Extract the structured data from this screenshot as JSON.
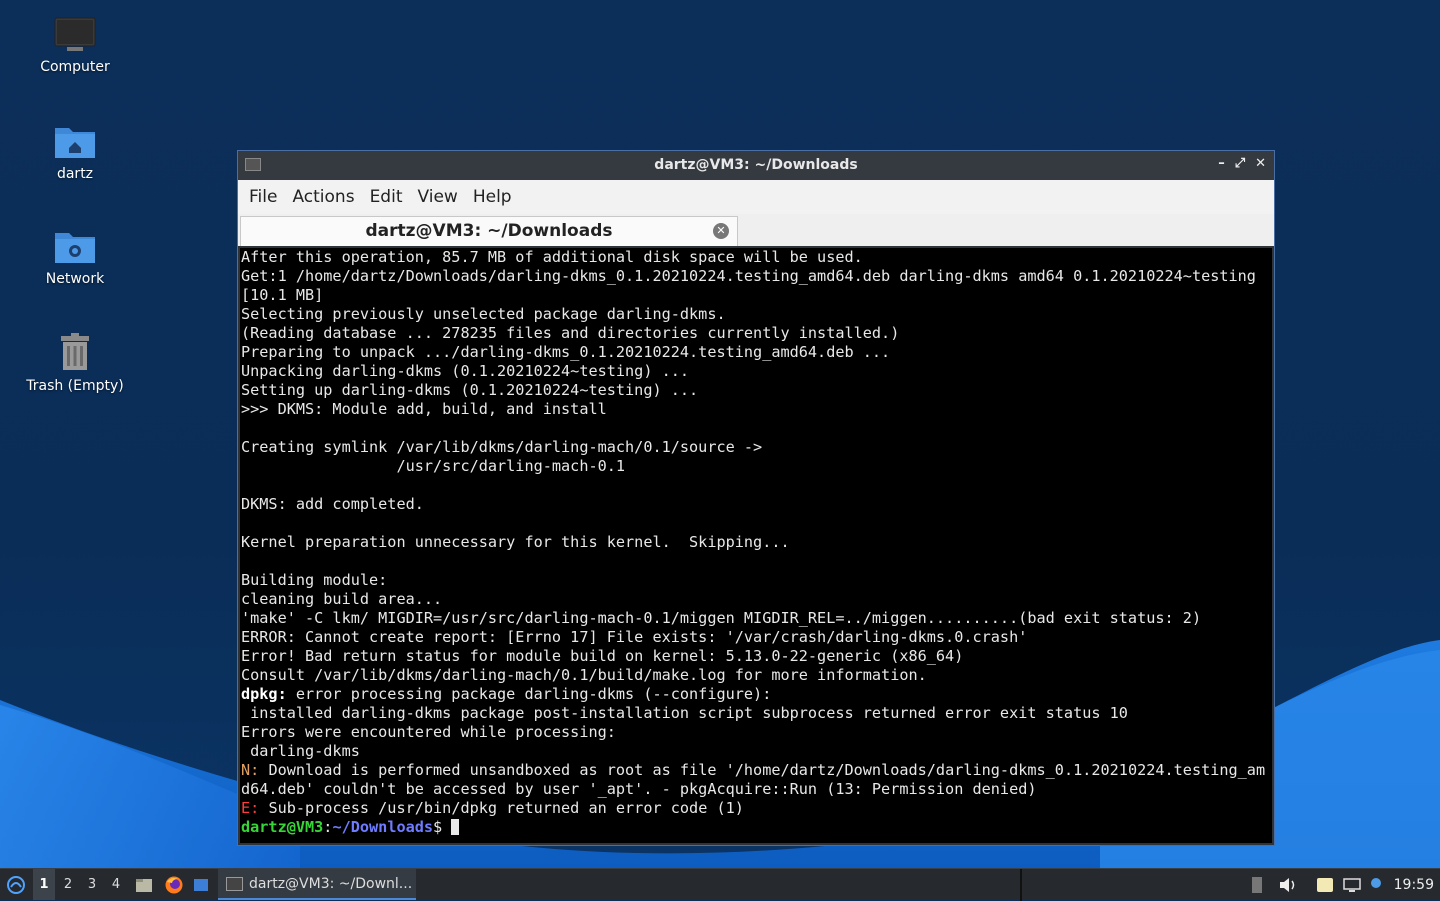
{
  "desktop": {
    "icons": [
      {
        "label": "Computer",
        "icon": "computer-icon"
      },
      {
        "label": "dartz",
        "icon": "home-folder-icon"
      },
      {
        "label": "Network",
        "icon": "network-folder-icon"
      },
      {
        "label": "Trash (Empty)",
        "icon": "trash-icon"
      }
    ]
  },
  "window": {
    "title": "dartz@VM3: ~/Downloads",
    "menu": [
      "File",
      "Actions",
      "Edit",
      "View",
      "Help"
    ],
    "tab_label": "dartz@VM3: ~/Downloads"
  },
  "terminal": {
    "lines": [
      "After this operation, 85.7 MB of additional disk space will be used.",
      "Get:1 /home/dartz/Downloads/darling-dkms_0.1.20210224.testing_amd64.deb darling-dkms amd64 0.1.20210224~testing",
      "[10.1 MB]",
      "Selecting previously unselected package darling-dkms.",
      "(Reading database ... 278235 files and directories currently installed.)",
      "Preparing to unpack .../darling-dkms_0.1.20210224.testing_amd64.deb ...",
      "Unpacking darling-dkms (0.1.20210224~testing) ...",
      "Setting up darling-dkms (0.1.20210224~testing) ...",
      ">>> DKMS: Module add, build, and install",
      "",
      "Creating symlink /var/lib/dkms/darling-mach/0.1/source ->",
      "                 /usr/src/darling-mach-0.1",
      "",
      "DKMS: add completed.",
      "",
      "Kernel preparation unnecessary for this kernel.  Skipping...",
      "",
      "Building module:",
      "cleaning build area...",
      "'make' -C lkm/ MIGDIR=/usr/src/darling-mach-0.1/miggen MIGDIR_REL=../miggen..........(bad exit status: 2)",
      "ERROR: Cannot create report: [Errno 17] File exists: '/var/crash/darling-dkms.0.crash'",
      "Error! Bad return status for module build on kernel: 5.13.0-22-generic (x86_64)",
      "Consult /var/lib/dkms/darling-mach/0.1/build/make.log for more information."
    ],
    "dpkg_prefix": "dpkg:",
    "dpkg_msg": " error processing package darling-dkms (--configure):",
    "lines2": [
      " installed darling-dkms package post-installation script subprocess returned error exit status 10",
      "Errors were encountered while processing:",
      " darling-dkms"
    ],
    "n_prefix": "N:",
    "n_msg1": " Download is performed unsandboxed as root as file '/home/dartz/Downloads/darling-dkms_0.1.20210224.testing_am",
    "n_msg2": "d64.deb' couldn't be accessed by user '_apt'. - pkgAcquire::Run (13: Permission denied)",
    "e_prefix": "E:",
    "e_msg": " Sub-process /usr/bin/dpkg returned an error code (1)",
    "prompt_user": "dartz@VM3",
    "prompt_colon": ":",
    "prompt_dir": "~/Downloads",
    "prompt_dollar": "$ "
  },
  "taskbar": {
    "workspaces": [
      "1",
      "2",
      "3",
      "4"
    ],
    "active_workspace": "1",
    "task_label": "dartz@VM3: ~/Downl...",
    "clock": "19:59"
  }
}
